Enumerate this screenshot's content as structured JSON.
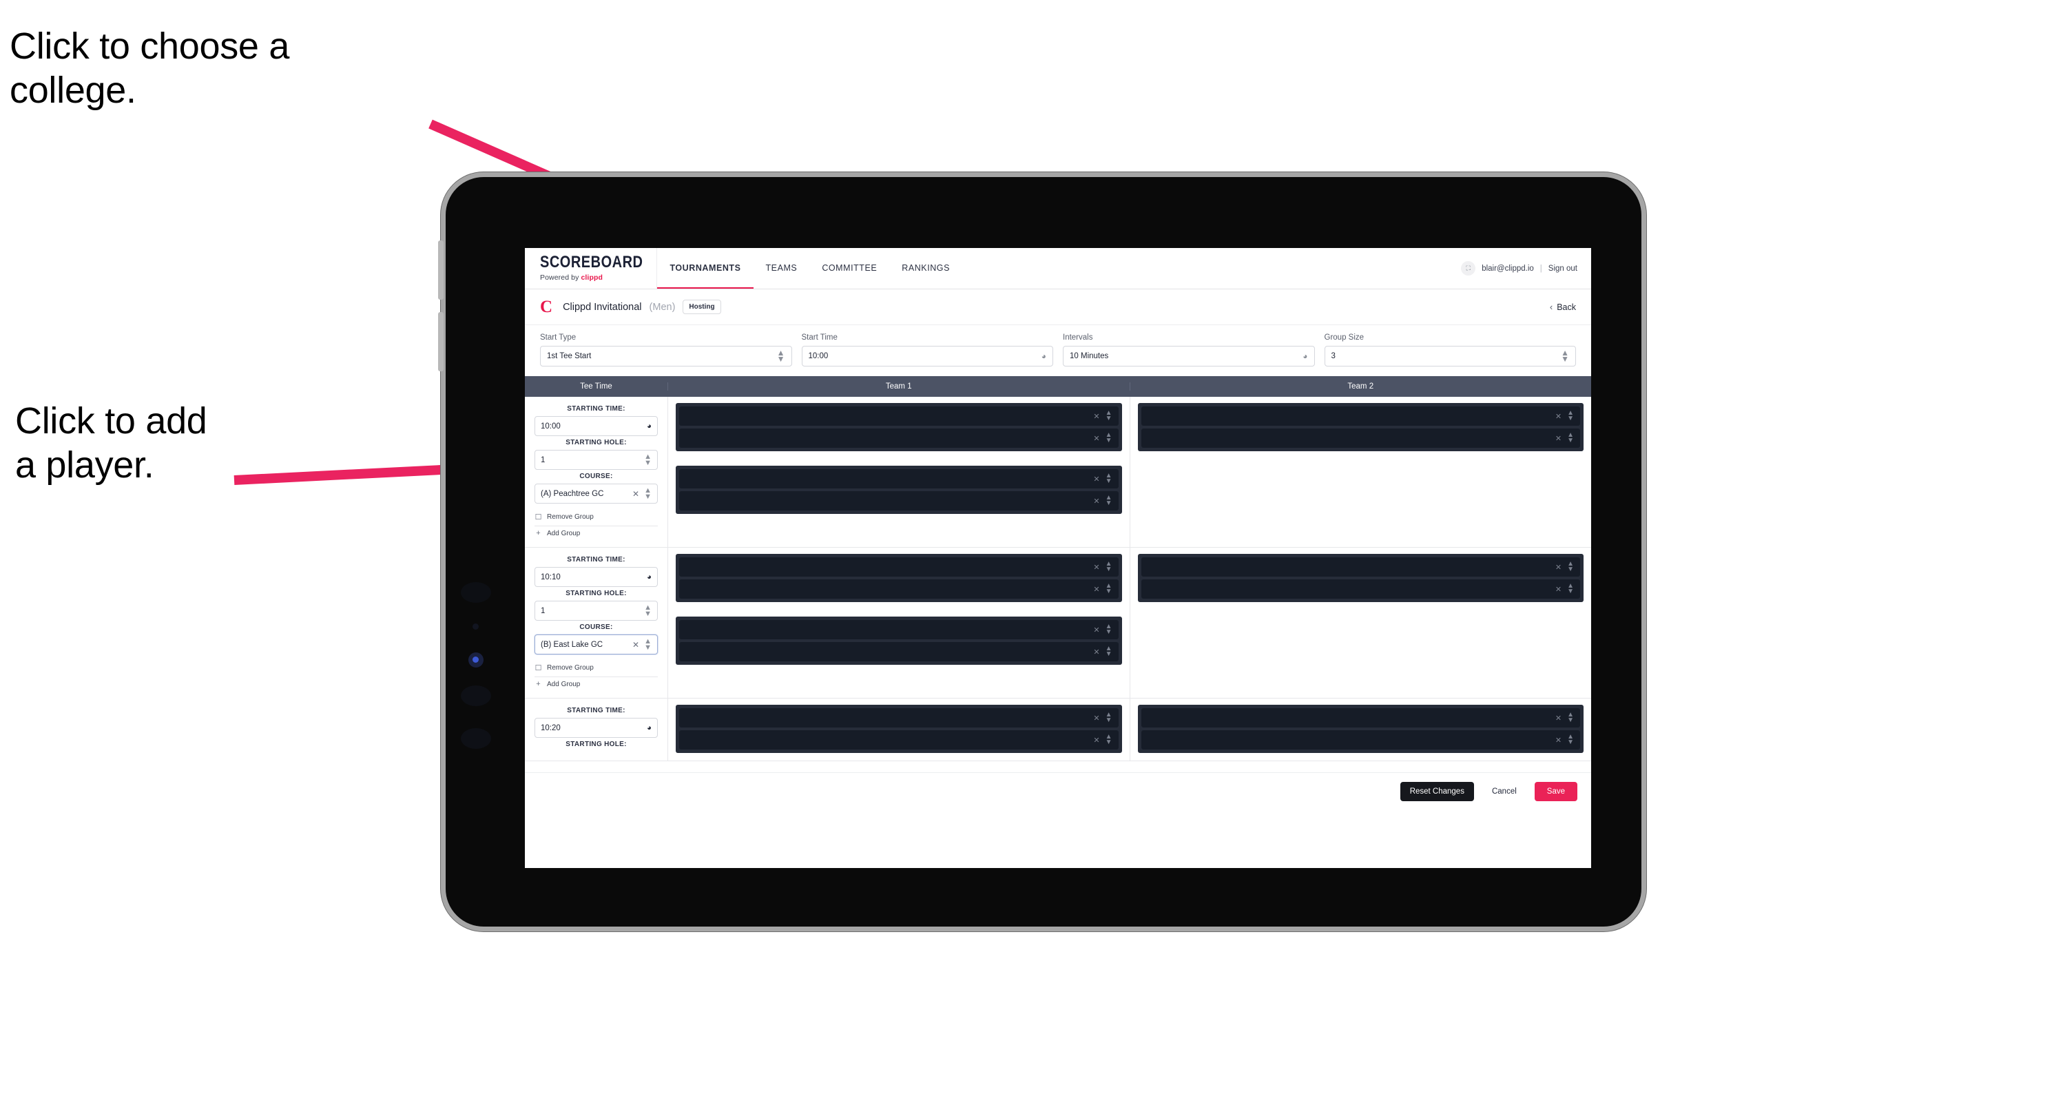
{
  "annotations": [
    {
      "id": "college",
      "text": "Click to choose a\ncollege."
    },
    {
      "id": "player",
      "text": "Click to add\na player."
    }
  ],
  "device": {
    "type": "tablet",
    "buttons": [
      "volume-up",
      "volume-down"
    ],
    "frame_color": "#a6a6a6"
  },
  "navbar": {
    "brand": {
      "wordmark": "SCOREBOARD",
      "tagline_prefix": "Powered by ",
      "tagline_brand": "clippd"
    },
    "tabs": [
      {
        "label": "TOURNAMENTS",
        "active": true
      },
      {
        "label": "TEAMS",
        "active": false
      },
      {
        "label": "COMMITTEE",
        "active": false
      },
      {
        "label": "RANKINGS",
        "active": false
      }
    ],
    "account": {
      "avatar_icon": "user-card-icon",
      "email": "blair@clippd.io",
      "separator": "|",
      "sign_out": "Sign out"
    }
  },
  "tournament_bar": {
    "logo": "C",
    "name": "Clippd Invitational",
    "gender": "(Men)",
    "badge": "Hosting",
    "back": {
      "chevron": "‹",
      "label": "Back"
    }
  },
  "filters": [
    {
      "label": "Start Type",
      "value": "1st Tee Start",
      "icon": "stepper-icon"
    },
    {
      "label": "Start Time",
      "value": "10:00",
      "icon": "clock-icon"
    },
    {
      "label": "Intervals",
      "value": "10 Minutes",
      "icon": "clock-icon"
    },
    {
      "label": "Group Size",
      "value": "3",
      "icon": "stepper-icon"
    }
  ],
  "table": {
    "headers": {
      "tee_time": "Tee Time",
      "team1": "Team 1",
      "team2": "Team 2"
    },
    "labels": {
      "starting_time": "STARTING TIME:",
      "starting_hole": "STARTING HOLE:",
      "course": "COURSE:",
      "remove_group": "Remove Group",
      "add_group": "Add Group",
      "remove_icon": "trash-icon",
      "add_icon": "plus-icon",
      "clock_icon": "clock-icon",
      "stepper_icon": "stepper-icon",
      "clear_icon": "clear-x-icon"
    },
    "rows": [
      {
        "starting_time": "10:00",
        "starting_hole": "1",
        "course": "(A) Peachtree GC",
        "course_focused": false,
        "team1_groups": [
          {
            "slots": 2
          },
          {
            "slots": 2
          }
        ],
        "team2_groups": [
          {
            "slots": 2
          }
        ]
      },
      {
        "starting_time": "10:10",
        "starting_hole": "1",
        "course": "(B) East Lake GC",
        "course_focused": true,
        "team1_groups": [
          {
            "slots": 2
          },
          {
            "slots": 2
          }
        ],
        "team2_groups": [
          {
            "slots": 2
          }
        ]
      },
      {
        "starting_time": "10:20",
        "starting_hole": "",
        "course": "",
        "partial": true,
        "team1_groups": [
          {
            "slots": 2
          }
        ],
        "team2_groups": [
          {
            "slots": 2
          }
        ]
      }
    ]
  },
  "footer": {
    "reset": "Reset Changes",
    "cancel": "Cancel",
    "save": "Save"
  },
  "colors": {
    "accent": "#e8174c",
    "save": "#ea2257",
    "table_header": "#4c5365",
    "player_group": "#262c39",
    "player_slot": "#161c27",
    "annotation_arrow": "#ea2360"
  }
}
